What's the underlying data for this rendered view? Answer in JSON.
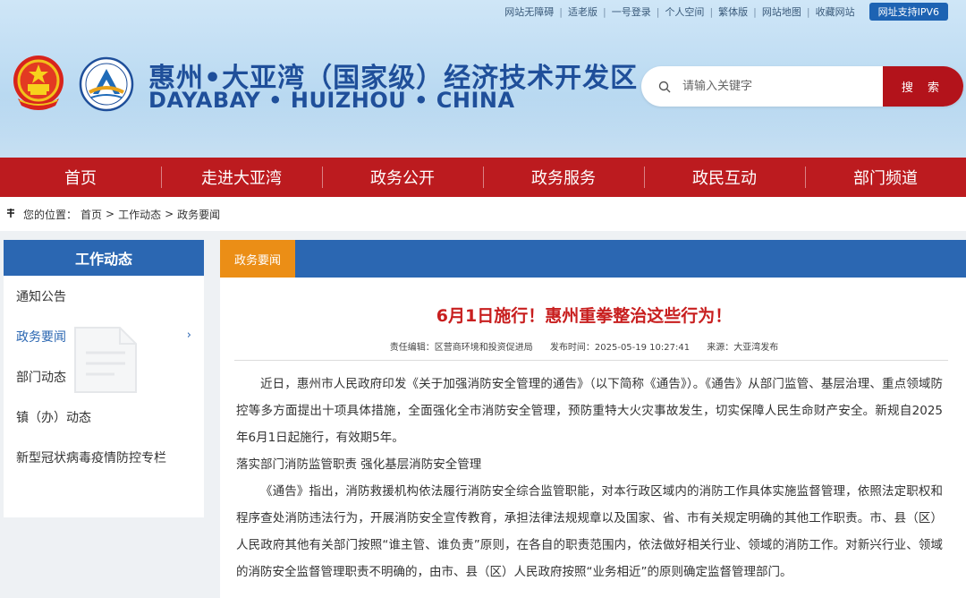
{
  "topbar": {
    "links": [
      "网站无障碍",
      "适老版",
      "一号登录",
      "个人空间",
      "繁体版",
      "网站地图",
      "收藏网站"
    ],
    "ipv6": "网址支持IPV6"
  },
  "site": {
    "title": "惠州•大亚湾（国家级）经济技术开发区",
    "subtitle": "DAYABAY • HUIZHOU • CHINA"
  },
  "search": {
    "placeholder": "请输入关键字",
    "button": "搜 索"
  },
  "nav": {
    "items": [
      "首页",
      "走进大亚湾",
      "政务公开",
      "政务服务",
      "政民互动",
      "部门频道"
    ]
  },
  "breadcrumb": {
    "label": "您的位置：",
    "items": [
      "首页",
      "工作动态",
      "政务要闻"
    ],
    "separator": ">"
  },
  "sidebar": {
    "title": "工作动态",
    "items": [
      "通知公告",
      "政务要闻",
      "部门动态",
      "镇（办）动态",
      "新型冠状病毒疫情防控专栏"
    ],
    "active_arrow": "›"
  },
  "content": {
    "tab": "政务要闻",
    "title": "6月1日施行！惠州重拳整治这些行为！",
    "meta": {
      "editor": "责任编辑：区营商环境和投资促进局",
      "time": "发布时间：2025-05-19 10:27:41",
      "source": "来源：大亚湾发布"
    },
    "paragraphs": [
      "近日，惠州市人民政府印发《关于加强消防安全管理的通告》（以下简称《通告》）。《通告》从部门监管、基层治理、重点领域防控等多方面提出十项具体措施，全面强化全市消防安全管理，预防重特大火灾事故发生，切实保障人民生命财产安全。新规自2025年6月1日起施行，有效期5年。",
      "落实部门消防监管职责 强化基层消防安全管理",
      "《通告》指出，消防救援机构依法履行消防安全综合监管职能，对本行政区域内的消防工作具体实施监督管理，依照法定职权和程序查处消防违法行为，开展消防安全宣传教育，承担法律法规规章以及国家、省、市有关规定明确的其他工作职责。市、县（区）人民政府其他有关部门按照“谁主管、谁负责”原则，在各自的职责范围内，依法做好相关行业、领域的消防工作。对新兴行业、领域的消防安全监督管理职责不明确的，由市、县（区）人民政府按照“业务相近”的原则确定监督管理部门。"
    ]
  },
  "colors": {
    "nav_red": "#bc1b1f",
    "brand_blue": "#2b67b2",
    "tab_orange": "#eb8e16",
    "title_red": "#c81f1f"
  }
}
